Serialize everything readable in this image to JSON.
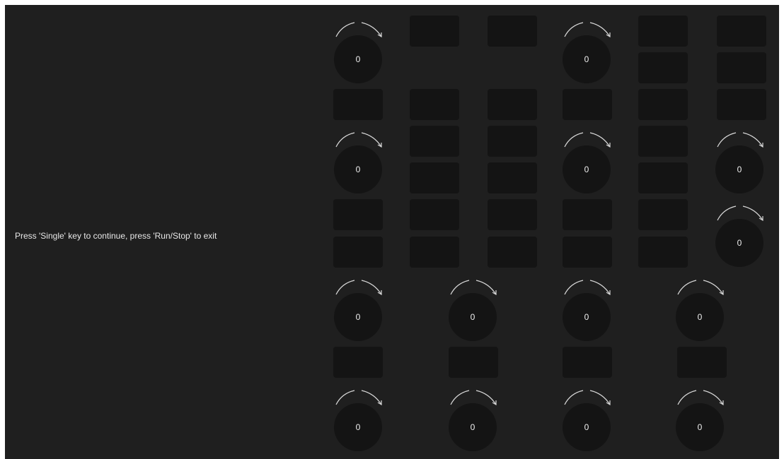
{
  "instruction": "Press 'Single' key to continue, press 'Run/Stop' to exit",
  "colors": {
    "background": "#1f1f1f",
    "key": "#141414",
    "text": "#e8e8e8",
    "arrow": "#d8d8d8"
  },
  "knob_icon": "rotate-arrows-icon",
  "knobs": [
    {
      "value": "0"
    },
    {
      "value": "0"
    },
    {
      "value": "0"
    },
    {
      "value": "0"
    },
    {
      "value": "0"
    },
    {
      "value": "0"
    },
    {
      "value": "0"
    },
    {
      "value": "0"
    },
    {
      "value": "0"
    },
    {
      "value": "0"
    },
    {
      "value": "0"
    },
    {
      "value": "0"
    },
    {
      "value": "0"
    },
    {
      "value": "0"
    }
  ]
}
